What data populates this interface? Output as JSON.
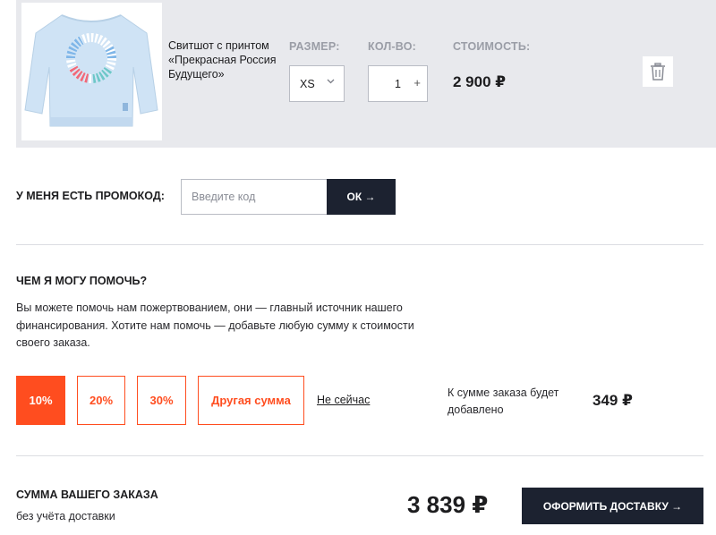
{
  "cart": {
    "product_name": "Свитшот с принтом «Прекрасная Россия Будущего»",
    "size_label": "РАЗМЕР:",
    "qty_label": "КОЛ-ВО:",
    "price_label": "СТОИМОСТЬ:",
    "size_value": "XS",
    "qty_value": "1",
    "qty_plus": "+",
    "price": "2 900 ₽",
    "icons": {
      "size_chevron": "chevron-down-icon",
      "delete": "trash-icon"
    }
  },
  "promo": {
    "label": "У МЕНЯ ЕСТЬ ПРОМОКОД:",
    "placeholder": "Введите код",
    "button": "ОК →"
  },
  "help": {
    "title": "ЧЕМ Я МОГУ ПОМОЧЬ?",
    "text": "Вы можете помочь нам пожертвованием, они — главный источник нашего финансирования. Хотите нам помочь — добавьте любую сумму к стоимости своего заказа.",
    "options": [
      "10%",
      "20%",
      "30%",
      "Другая сумма"
    ],
    "selected": "10%",
    "not_now": "Не сейчас",
    "added_text": "К сумме заказа будет добавлено",
    "added_amount": "349 ₽"
  },
  "summary": {
    "title": "СУММА ВАШЕГО ЗАКАЗА",
    "subtitle": "без учёта доставки",
    "total": "3 839 ₽",
    "checkout": "ОФОРМИТЬ ДОСТАВКУ →"
  },
  "colors": {
    "accent": "#ff4d1f",
    "dark": "#1c2230",
    "row_bg": "#e8e9ed"
  }
}
